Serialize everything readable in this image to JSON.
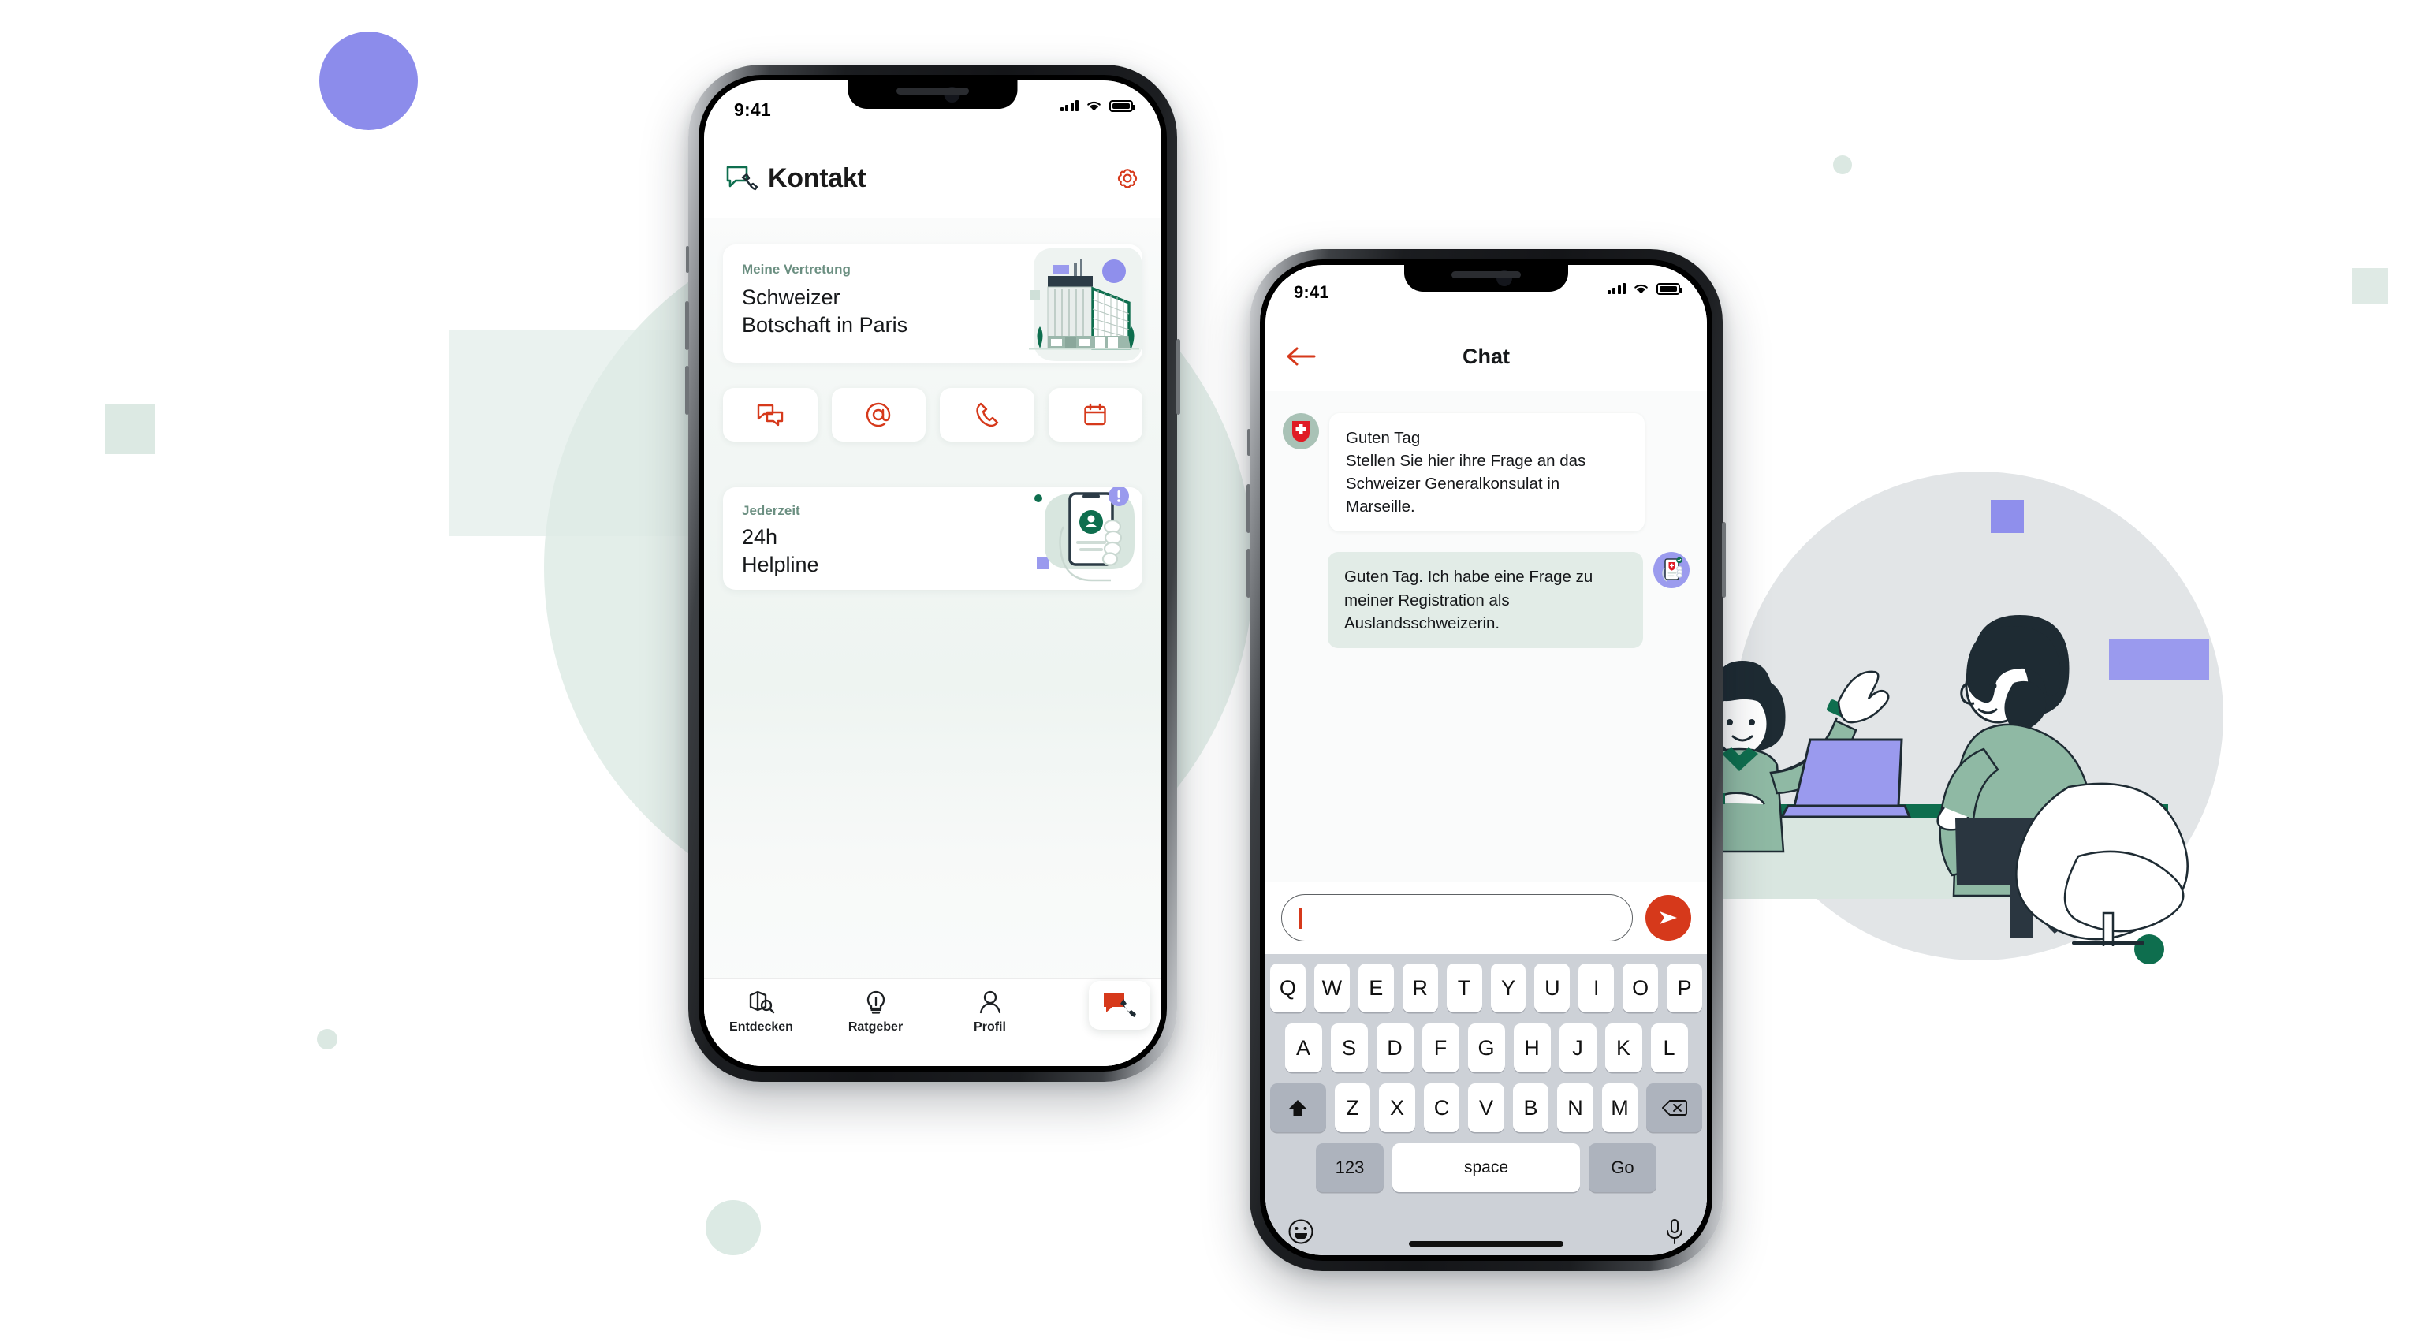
{
  "brand": {
    "accent_red": "#D6391B",
    "accent_green": "#0E6E4E",
    "accent_lavender": "#9A9AEE",
    "mint_bg": "#DCE9E3"
  },
  "phone_one": {
    "status_bar": {
      "time": "9:41",
      "signal_icon": "cellular-signal-icon",
      "wifi_icon": "wifi-icon",
      "battery_icon": "battery-icon"
    },
    "header": {
      "logo_icon": "chat-phone-icon",
      "title": "Kontakt",
      "settings_icon": "gear-icon"
    },
    "representation_card": {
      "eyebrow": "Meine Vertretung",
      "title_line_1": "Schweizer",
      "title_line_2": "Botschaft in Paris",
      "illustration": "embassy-building-illustration"
    },
    "quick_actions": [
      {
        "name": "chat",
        "icon": "chat-bubbles-icon"
      },
      {
        "name": "email",
        "icon": "at-sign-icon"
      },
      {
        "name": "phone",
        "icon": "phone-handset-icon"
      },
      {
        "name": "appointment",
        "icon": "calendar-icon"
      }
    ],
    "helpline_card": {
      "eyebrow": "Jederzeit",
      "title_line_1": "24h",
      "title_line_2": "Helpline",
      "illustration": "hand-holding-phone-illustration"
    },
    "tab_bar": {
      "items": [
        {
          "label": "Entdecken",
          "icon": "map-search-icon"
        },
        {
          "label": "Ratgeber",
          "icon": "lightbulb-icon"
        },
        {
          "label": "Profil",
          "icon": "person-icon"
        }
      ],
      "fab_icon": "chat-phone-icon"
    }
  },
  "phone_two": {
    "status_bar": {
      "time": "9:41",
      "signal_icon": "cellular-signal-icon",
      "wifi_icon": "wifi-icon",
      "battery_icon": "battery-icon"
    },
    "header": {
      "back_icon": "arrow-left-icon",
      "title": "Chat"
    },
    "messages": [
      {
        "direction": "in",
        "avatar_icon": "swiss-coat-of-arms-icon",
        "text": "Guten Tag\nStellen Sie hier ihre Frage an das Schweizer Generalkonsulat in Marseille."
      },
      {
        "direction": "out",
        "avatar_icon": "swiss-app-phone-icon",
        "text": "Guten Tag. Ich habe eine Frage zu meiner Registration als Auslandsschweizerin."
      }
    ],
    "composer": {
      "value": "",
      "placeholder": "",
      "send_icon": "send-paper-plane-icon"
    },
    "keyboard": {
      "row_1": [
        "Q",
        "W",
        "E",
        "R",
        "T",
        "Y",
        "U",
        "I",
        "O",
        "P"
      ],
      "row_2": [
        "A",
        "S",
        "D",
        "F",
        "G",
        "H",
        "J",
        "K",
        "L"
      ],
      "row_3": [
        "Z",
        "X",
        "C",
        "V",
        "B",
        "N",
        "M"
      ],
      "shift_icon": "shift-arrow-icon",
      "backspace_icon": "backspace-icon",
      "numbers_key": "123",
      "space_key": "space",
      "return_key": "Go",
      "emoji_icon": "emoji-smiley-icon",
      "mic_icon": "microphone-icon"
    }
  },
  "illustration": {
    "name": "consulate-counter-scene-illustration",
    "elements": [
      "woman-agent",
      "laptop",
      "desk",
      "seated-man",
      "armchair"
    ]
  }
}
